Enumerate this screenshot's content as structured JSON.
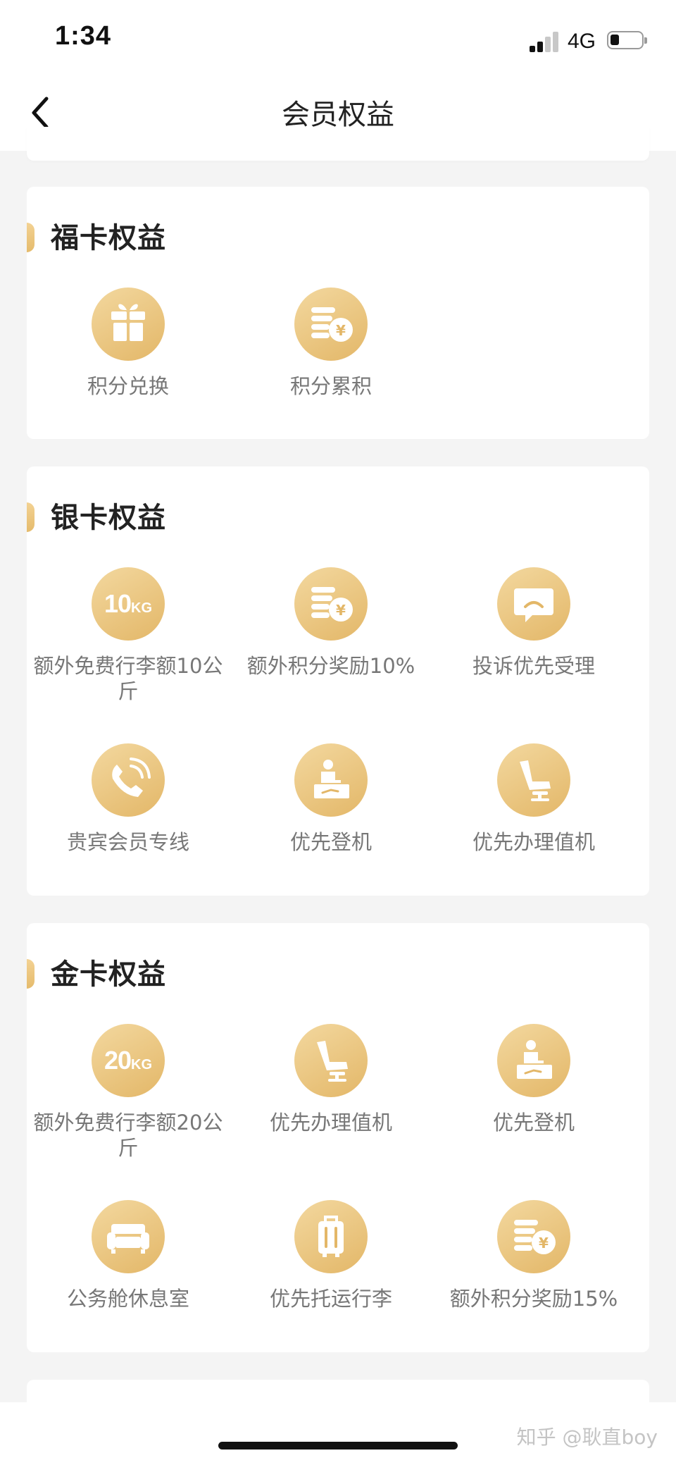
{
  "status_bar": {
    "time": "1:34",
    "network": "4G"
  },
  "nav": {
    "title": "会员权益"
  },
  "sections": [
    {
      "title": "福卡权益",
      "items": [
        {
          "label": "积分兑换",
          "icon": "gift-icon"
        },
        {
          "label": "积分累积",
          "icon": "coins-yen-icon"
        }
      ]
    },
    {
      "title": "银卡权益",
      "items": [
        {
          "label": "额外免费行李额10公斤",
          "icon": "baggage-10kg-icon",
          "kg_num": "10",
          "kg_unit": "KG"
        },
        {
          "label": "额外积分奖励10%",
          "icon": "coins-yen-icon"
        },
        {
          "label": "投诉优先受理",
          "icon": "complaint-chat-icon"
        },
        {
          "label": "贵宾会员专线",
          "icon": "phone-call-icon"
        },
        {
          "label": "优先登机",
          "icon": "boarding-icon"
        },
        {
          "label": "优先办理值机",
          "icon": "seat-icon"
        }
      ]
    },
    {
      "title": "金卡权益",
      "items": [
        {
          "label": "额外免费行李额20公斤",
          "icon": "baggage-20kg-icon",
          "kg_num": "20",
          "kg_unit": "KG"
        },
        {
          "label": "优先办理值机",
          "icon": "seat-icon"
        },
        {
          "label": "优先登机",
          "icon": "boarding-icon"
        },
        {
          "label": "公务舱休息室",
          "icon": "sofa-icon"
        },
        {
          "label": "优先托运行李",
          "icon": "luggage-icon"
        },
        {
          "label": "额外积分奖励15%",
          "icon": "coins-yen-icon"
        }
      ]
    }
  ],
  "watermark": "知乎 @耿直boy",
  "colors": {
    "gold_light": "#f3d89f",
    "gold_dark": "#e3b768",
    "background": "#f4f4f4"
  }
}
